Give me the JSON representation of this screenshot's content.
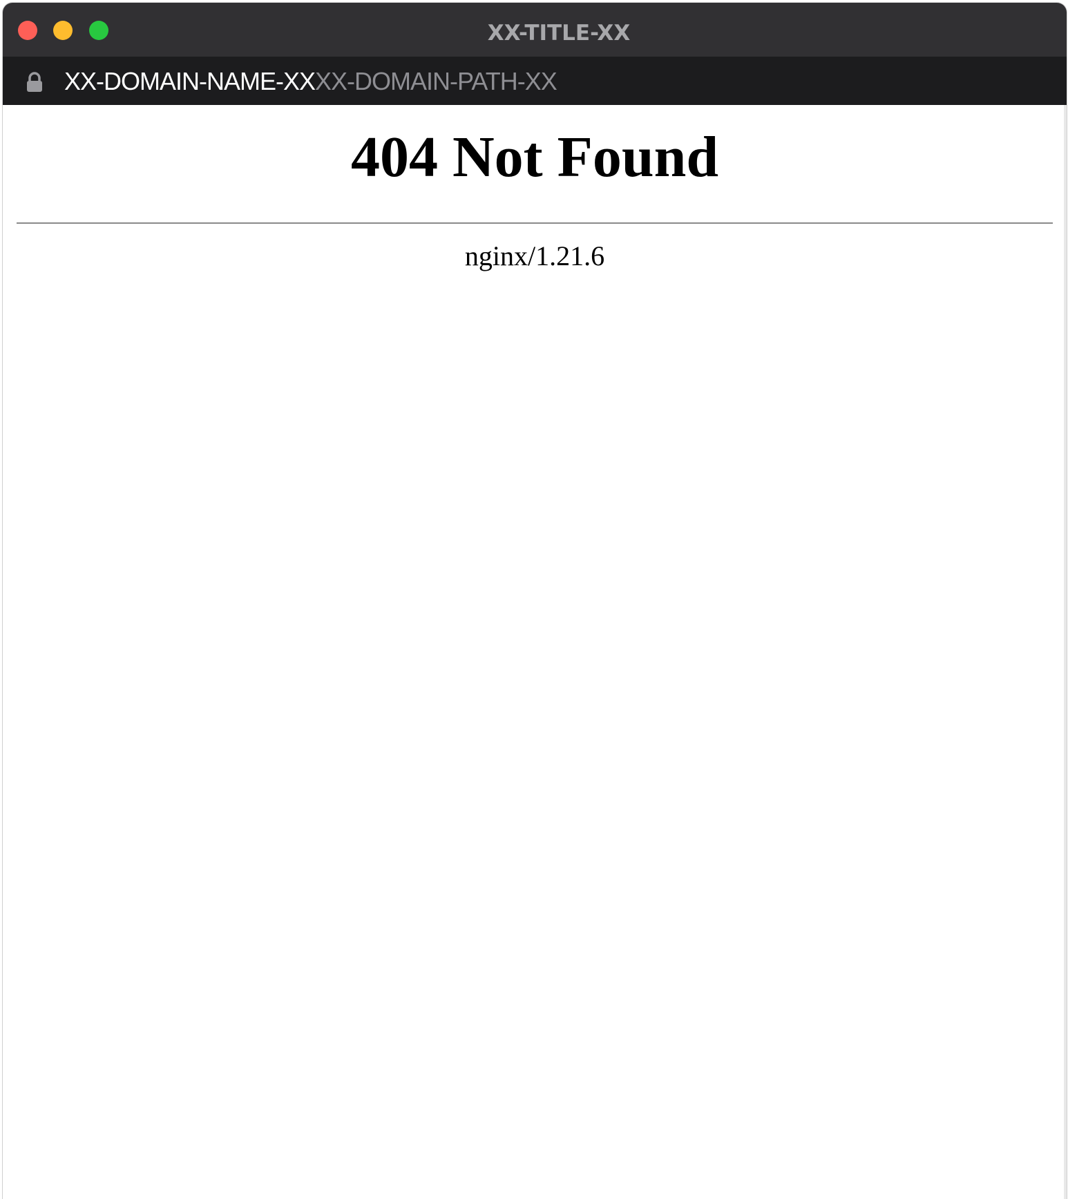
{
  "window": {
    "title": "XX-TITLE-XX",
    "traffic_lights": {
      "close_color": "#fe5f57",
      "minimize_color": "#febc2e",
      "zoom_color": "#28c840"
    }
  },
  "address_bar": {
    "lock_icon": "lock-icon",
    "domain": "XX-DOMAIN-NAME-XX",
    "path": "XX-DOMAIN-PATH-XX"
  },
  "page": {
    "heading": "404 Not Found",
    "server_signature": "nginx/1.21.6"
  }
}
